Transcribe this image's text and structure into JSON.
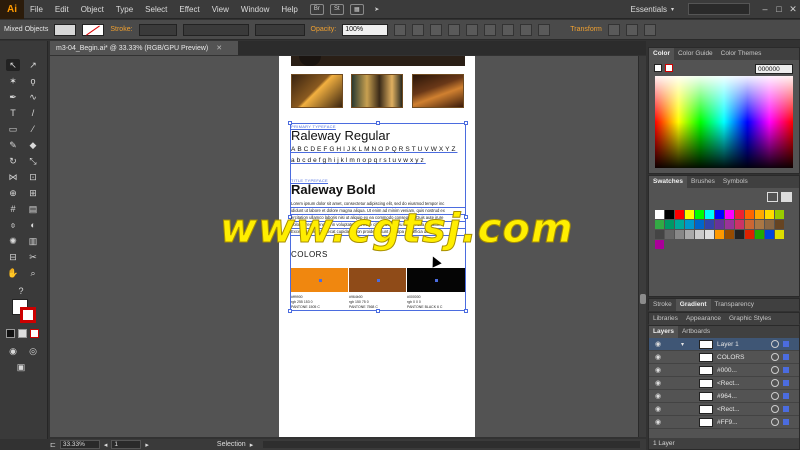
{
  "app": {
    "logo": "Ai",
    "menu": [
      "File",
      "Edit",
      "Object",
      "Type",
      "Select",
      "Effect",
      "View",
      "Window",
      "Help"
    ],
    "bridge_icon": "Br",
    "stock_icon": "St",
    "workspace": "Essentials",
    "window_controls": [
      "–",
      "□",
      "✕"
    ]
  },
  "control_bar": {
    "selection_type": "Mixed Objects",
    "stroke_label": "Stroke:",
    "opacity_label": "Opacity:",
    "opacity_value": "100%",
    "transform_label": "Transform"
  },
  "document": {
    "tab_title": "m3-04_Begin.ai* @ 33.33% (RGB/GPU Preview)",
    "close": "✕"
  },
  "artboard": {
    "primary_label": "PRIMARY TYPEFACE",
    "primary_font": "Raleway Regular",
    "primary_upper": "ABCDEFGHIJKLMNOPQRSTUVWXYZ",
    "primary_lower": "abcdefghijklmnopqrstuvwxyz",
    "title_label": "TITLE TYPEFACE",
    "title_font": "Raleway Bold",
    "lorem_lines": [
      "Lorem ipsum dolor sit amet, consectetur adipiscing elit, sed do eiusmod tempor inc",
      "ididunt ut labore et dolore magna aliqua. Ut enim ad minim veniam, quis nostrud ex",
      "ercitation ullamco laboris nisi ut aliquip ex ea commodo consequat. Duis aute irure",
      "dolor in reprehenderit in voluptate velit esse cillum dolore eu fugiat nulla pariatur.",
      "Excepteur sint occaecat cupidatat non proident, sunt in culpa qui officia deserunt"
    ],
    "colors_title": "COLORS",
    "swatches": [
      {
        "color": "#f0870f",
        "hex": "#ff9900",
        "rgb": "rgb 255 153 0",
        "pantone": "PANTONE 1505 C"
      },
      {
        "color": "#8f4b18",
        "hex": "#964b00",
        "rgb": "rgb 150 75 0",
        "pantone": "PANTONE 7568 C"
      },
      {
        "color": "#050505",
        "hex": "#000000",
        "rgb": "rgb 0 0 0",
        "pantone": "PANTONE BLACK 6 C"
      }
    ],
    "watermark": "www.cgtsj.com"
  },
  "status_bar": {
    "zoom": "33.33%",
    "artboard_num": "1",
    "tool": "Selection"
  },
  "color_panel": {
    "tabs": [
      "Color",
      "Color Guide",
      "Color Themes"
    ],
    "hex": "000000"
  },
  "swatches_panel": {
    "tabs": [
      "Swatches",
      "Brushes",
      "Symbols"
    ]
  },
  "stroke_panel": {
    "tabs": [
      "Stroke",
      "Gradient",
      "Transparency"
    ]
  },
  "libraries_panel": {
    "tabs": [
      "Libraries",
      "Appearance",
      "Graphic Styles"
    ]
  },
  "layers_panel": {
    "tabs": [
      "Layers",
      "Artboards"
    ],
    "layers": [
      "Layer 1",
      "COLORS",
      "#000...",
      "<Rect...",
      "#964...",
      "<Rect...",
      "#FF9..."
    ],
    "footer": "1 Layer"
  }
}
